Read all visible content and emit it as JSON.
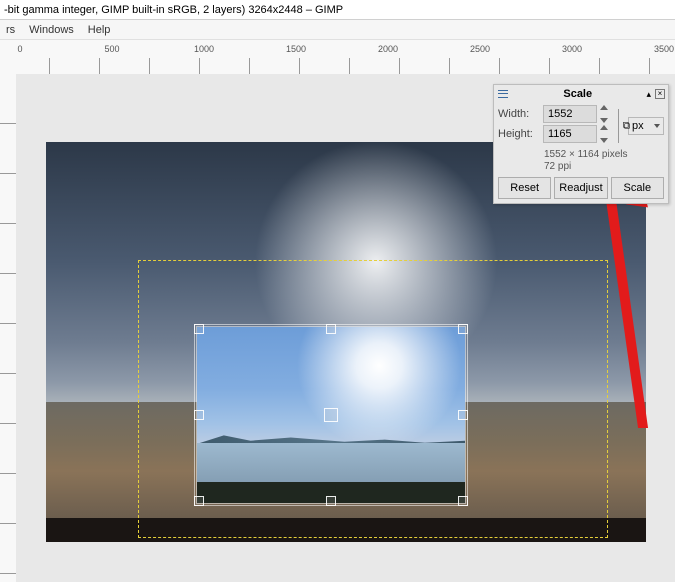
{
  "window": {
    "title": "-bit gamma integer, GIMP built-in sRGB, 2 layers) 3264x2448 – GIMP"
  },
  "menubar": {
    "items": [
      "rs",
      "Windows",
      "Help"
    ]
  },
  "ruler": {
    "ticks": [
      0,
      500,
      1000,
      1500,
      2000,
      2500,
      3000,
      3500
    ]
  },
  "scale_dialog": {
    "title": "Scale",
    "width_label": "Width:",
    "height_label": "Height:",
    "width_value": "1552",
    "height_value": "1165",
    "unit": "px",
    "info_line1": "1552 × 1164 pixels",
    "info_line2": "72 ppi",
    "buttons": {
      "reset": "Reset",
      "readjust": "Readjust",
      "scale": "Scale"
    }
  }
}
